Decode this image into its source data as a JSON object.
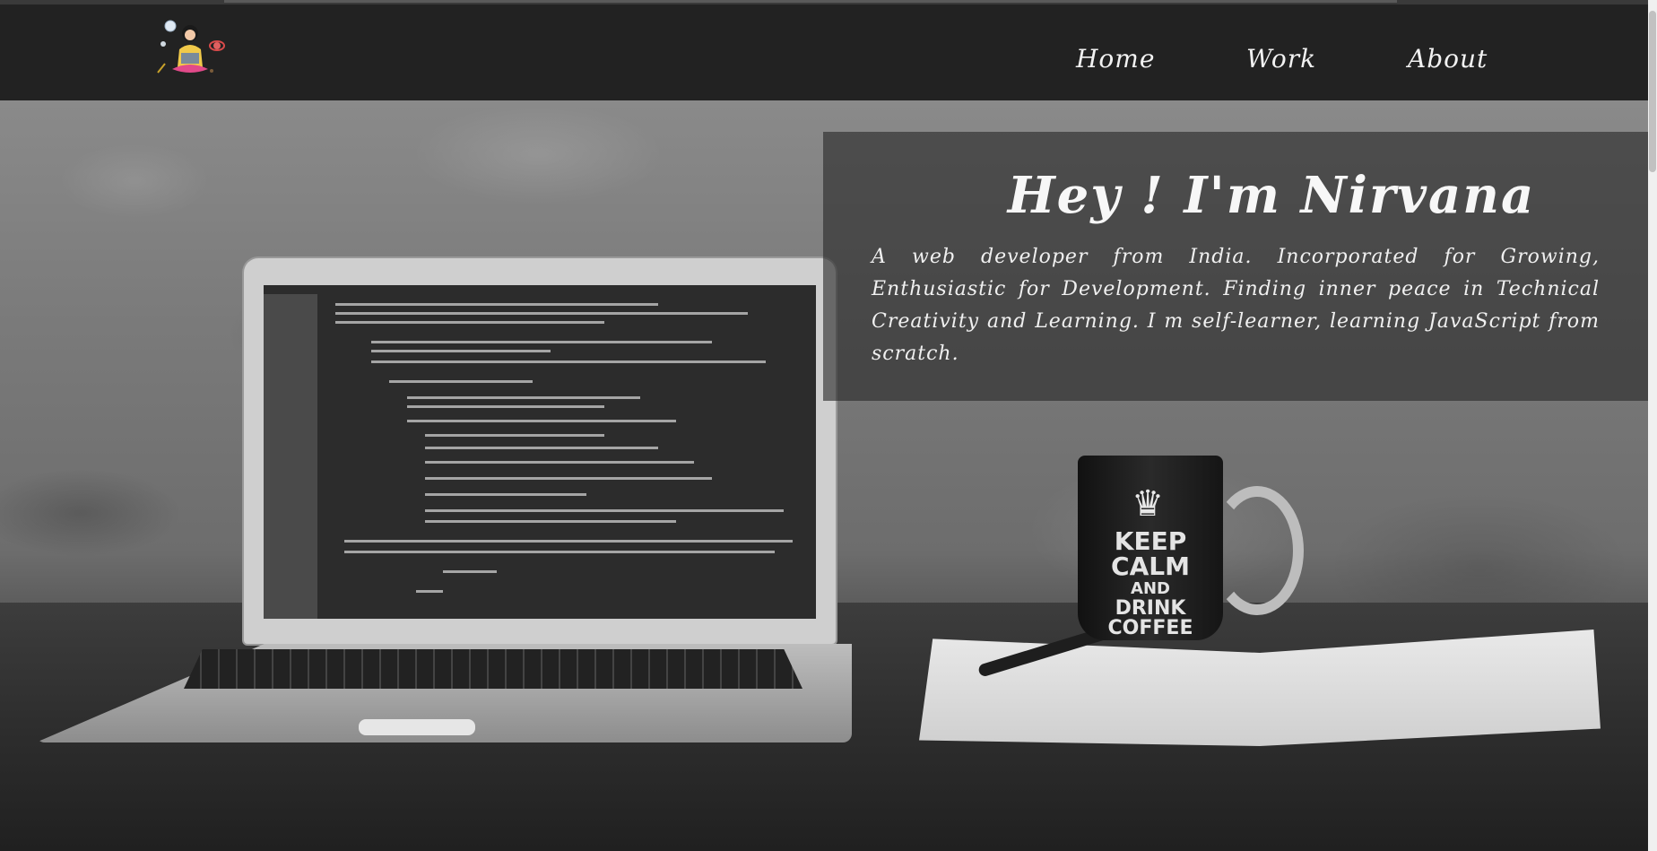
{
  "nav": {
    "logo_icon": "girl-with-laptop-logo-icon",
    "links": [
      {
        "label": "Home"
      },
      {
        "label": "Work"
      },
      {
        "label": "About"
      }
    ]
  },
  "hero": {
    "title": "Hey ! I'm Nirvana",
    "description": "A web developer from India. Incorporated for Growing, Enthusiastic for Development. Finding inner peace in Technical Creativity and Learning. I m self-learner, learning JavaScript from scratch.",
    "background_image": "laptop-and-keep-calm-mug-photo",
    "mug": {
      "line1": "KEEP",
      "line2": "CALM",
      "line3": "AND",
      "line4": "DRINK",
      "line5": "COFFEE"
    }
  },
  "colors": {
    "navbar_bg": "#222222",
    "overlay_bg": "rgba(40,40,40,0.62)",
    "text": "#f7f7f7"
  }
}
